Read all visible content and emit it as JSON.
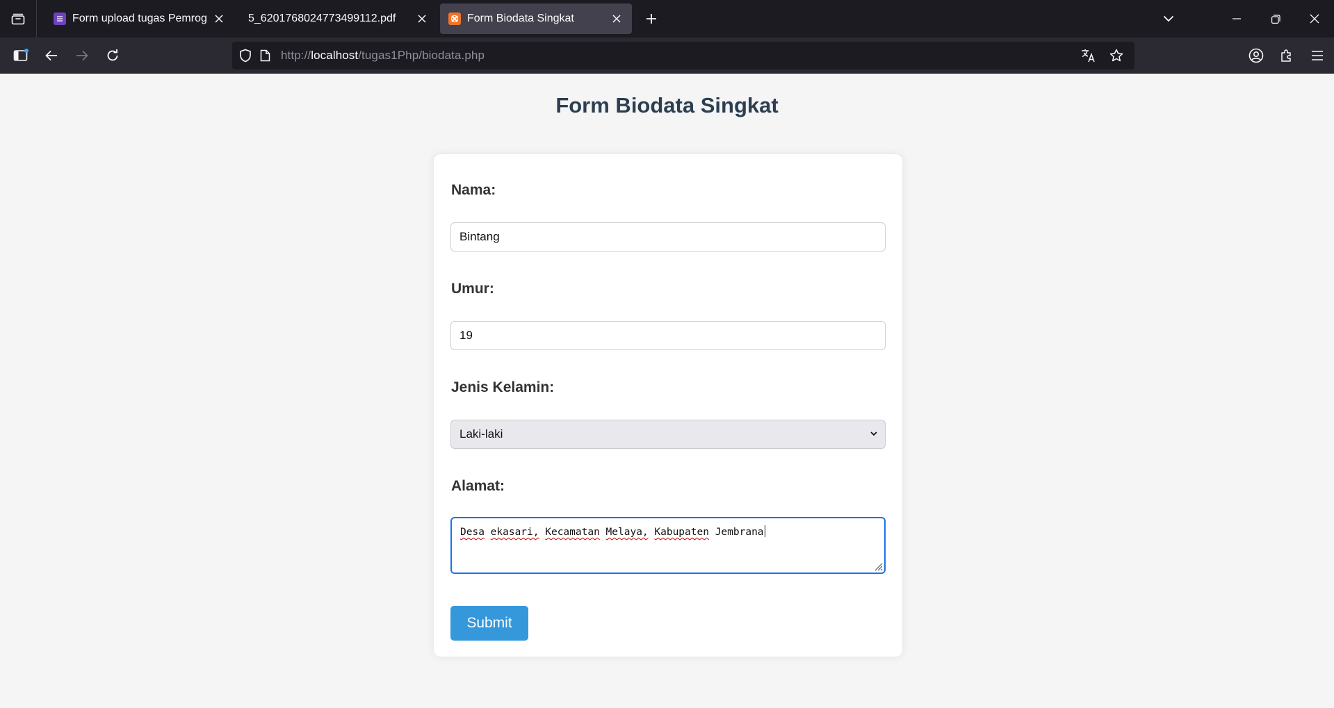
{
  "browser": {
    "tabs": [
      {
        "title": "Form upload tugas Pemrograman",
        "favicon_color": "#6f42c1",
        "active": false
      },
      {
        "title": "5_6201768024773499112.pdf",
        "active": false
      },
      {
        "title": "Form Biodata Singkat",
        "favicon_color": "#f0732a",
        "active": true
      }
    ],
    "url": {
      "scheme": "http://",
      "host": "localhost",
      "path": "/tugas1Php/biodata.php"
    }
  },
  "page": {
    "title": "Form Biodata Singkat",
    "form": {
      "nama_label": "Nama:",
      "nama_value": "Bintang",
      "umur_label": "Umur:",
      "umur_value": "19",
      "jenis_kelamin_label": "Jenis Kelamin:",
      "jenis_kelamin_selected": "Laki-laki",
      "alamat_label": "Alamat:",
      "alamat_words": [
        "Desa",
        "ekasari,",
        "Kecamatan",
        "Melaya,",
        "Kabupaten",
        "Jembrana"
      ],
      "submit_label": "Submit"
    }
  },
  "colors": {
    "accent": "#3498db",
    "title": "#2c3e50",
    "focus_border": "#1a73e8"
  }
}
